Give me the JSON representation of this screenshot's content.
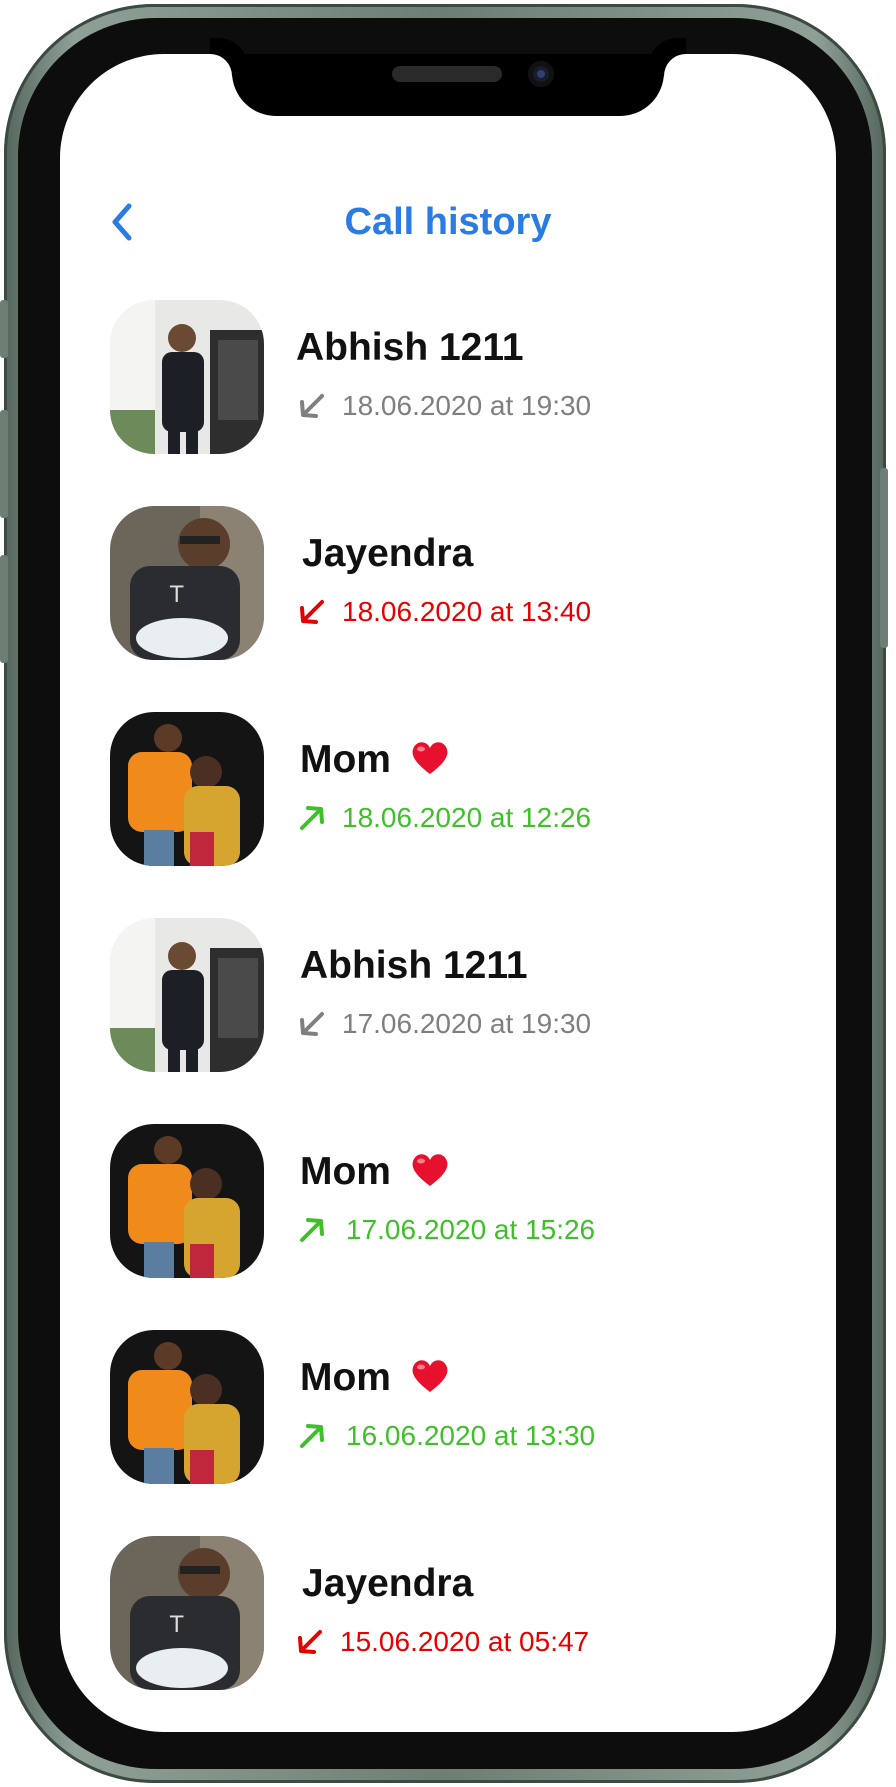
{
  "header": {
    "title": "Call history",
    "back_icon": "chevron-left-icon",
    "accent": "#2a7be4"
  },
  "status_colors": {
    "incoming": "#7f7f7f",
    "missed": "#e60000",
    "outgoing": "#3fbf2a"
  },
  "calls": [
    {
      "name": "Abhish 1211",
      "heart": false,
      "datetime": "18.06.2020 at 19:30",
      "type": "incoming",
      "avatar": "man-standing"
    },
    {
      "name": "Jayendra",
      "heart": false,
      "datetime": "18.06.2020 at 13:40",
      "type": "missed",
      "avatar": "man-glasses"
    },
    {
      "name": "Mom",
      "heart": true,
      "datetime": "18.06.2020 at 12:26",
      "type": "outgoing",
      "avatar": "couple"
    },
    {
      "name": "Abhish 1211",
      "heart": false,
      "datetime": "17.06.2020 at 19:30",
      "type": "incoming",
      "avatar": "man-standing"
    },
    {
      "name": "Mom",
      "heart": true,
      "datetime": "17.06.2020 at 15:26",
      "type": "outgoing",
      "avatar": "couple"
    },
    {
      "name": "Mom",
      "heart": true,
      "datetime": "16.06.2020 at 13:30",
      "type": "outgoing",
      "avatar": "couple"
    },
    {
      "name": "Jayendra",
      "heart": false,
      "datetime": "15.06.2020 at 05:47",
      "type": "missed",
      "avatar": "man-glasses"
    }
  ]
}
